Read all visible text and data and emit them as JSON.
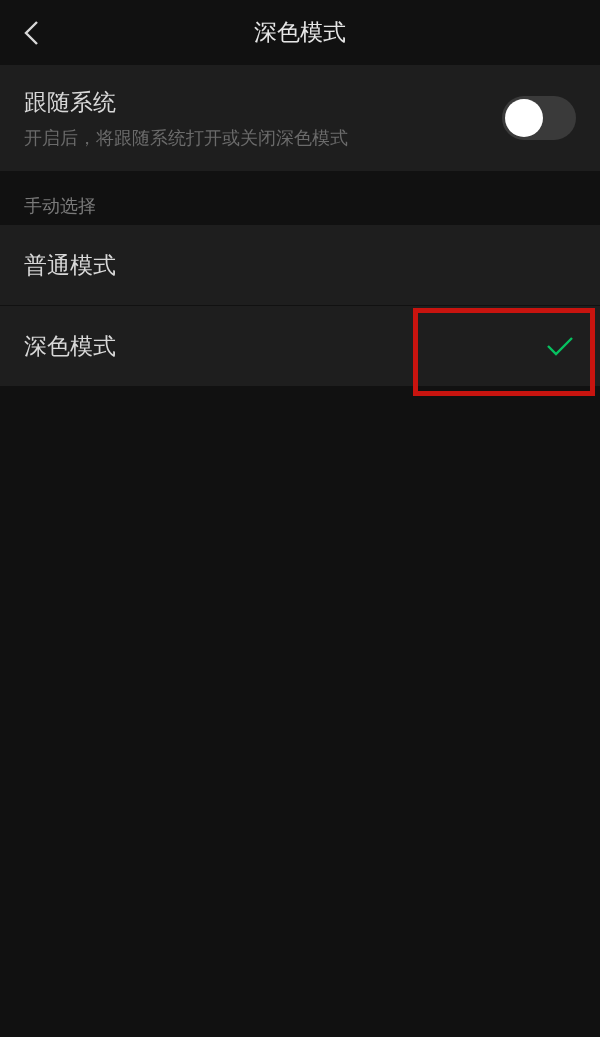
{
  "nav_bar": {
    "title": "深色模式"
  },
  "follow_system": {
    "label": "跟随系统",
    "description": "开启后，将跟随系统打开或关闭深色模式",
    "on": false
  },
  "section_header": "手动选择",
  "modes": [
    {
      "label": "普通模式",
      "selected": false,
      "highlighted": false
    },
    {
      "label": "深色模式",
      "selected": true,
      "highlighted": true
    }
  ]
}
